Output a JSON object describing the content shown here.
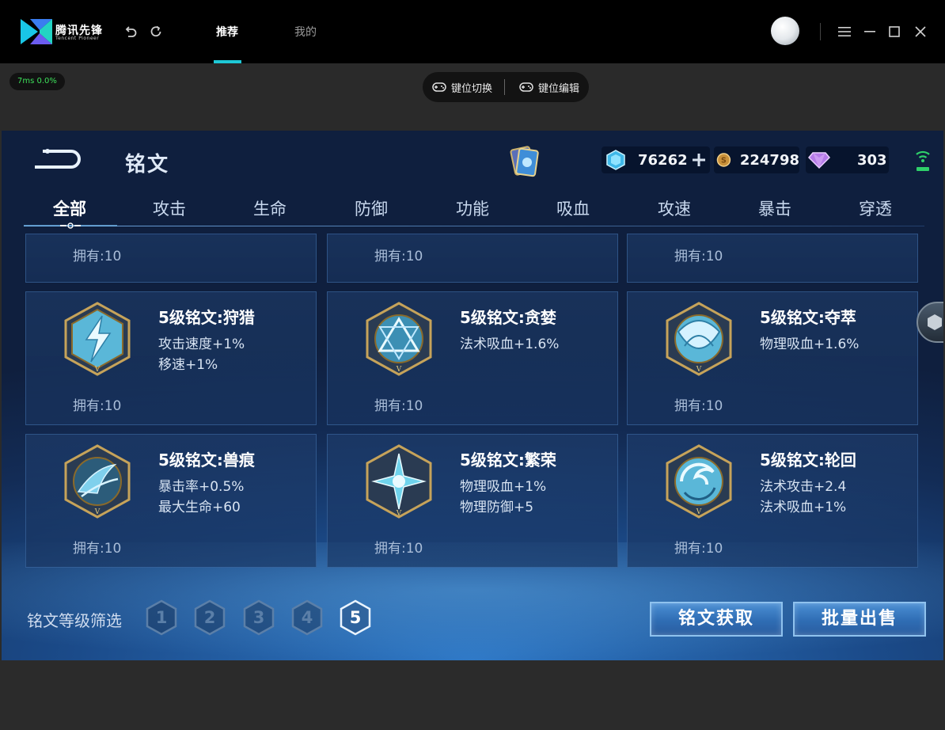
{
  "titlebar": {
    "app_name": "腾讯先锋",
    "app_sub": "Tencent Pioneer",
    "tabs": [
      {
        "label": "推荐",
        "active": true
      },
      {
        "label": "我的",
        "active": false
      }
    ],
    "icons": [
      "undo-icon",
      "refresh-icon",
      "menu-icon",
      "minimize-icon",
      "maximize-icon",
      "close-icon"
    ]
  },
  "toolbar": {
    "ping": "7ms  0.0%",
    "key_switch": "键位切换",
    "key_edit": "键位编辑"
  },
  "game": {
    "title": "铭文",
    "currencies": [
      {
        "name": "crystal",
        "value": "76262",
        "icon": "crystal-icon",
        "color": "#5fd1f0"
      },
      {
        "name": "gold",
        "value": "224798",
        "icon": "gold-coin-icon",
        "color": "#d6a54a"
      },
      {
        "name": "gem",
        "value": "303",
        "icon": "diamond-icon",
        "color": "#c88cf0"
      }
    ],
    "categories": [
      "全部",
      "攻击",
      "生命",
      "防御",
      "功能",
      "吸血",
      "攻速",
      "暴击",
      "穿透"
    ],
    "active_category": "全部",
    "partial_row": [
      {
        "owned": "拥有:10"
      },
      {
        "owned": "拥有:10"
      },
      {
        "owned": "拥有:10"
      }
    ],
    "runes": [
      {
        "name": "5级铭文:狩猎",
        "stats": [
          "攻击速度+1%",
          "移速+1%"
        ],
        "owned": "拥有:10",
        "icon": "lightning-rune-icon"
      },
      {
        "name": "5级铭文:贪婪",
        "stats": [
          "法术吸血+1.6%"
        ],
        "owned": "拥有:10",
        "icon": "triangle-rune-icon"
      },
      {
        "name": "5级铭文:夺萃",
        "stats": [
          "物理吸血+1.6%"
        ],
        "owned": "拥有:10",
        "icon": "knot-rune-icon"
      },
      {
        "name": "5级铭文:兽痕",
        "stats": [
          "暴击率+0.5%",
          "最大生命+60"
        ],
        "owned": "拥有:10",
        "icon": "claw-rune-icon"
      },
      {
        "name": "5级铭文:繁荣",
        "stats": [
          "物理吸血+1%",
          "物理防御+5"
        ],
        "owned": "拥有:10",
        "icon": "star-rune-icon"
      },
      {
        "name": "5级铭文:轮回",
        "stats": [
          "法术攻击+2.4",
          "法术吸血+1%"
        ],
        "owned": "拥有:10",
        "icon": "swirl-rune-icon"
      }
    ],
    "filter_label": "铭文等级筛选",
    "levels": [
      "1",
      "2",
      "3",
      "4",
      "5"
    ],
    "active_level": "5",
    "buttons": {
      "acquire": "铭文获取",
      "bulk_sell": "批量出售"
    }
  }
}
